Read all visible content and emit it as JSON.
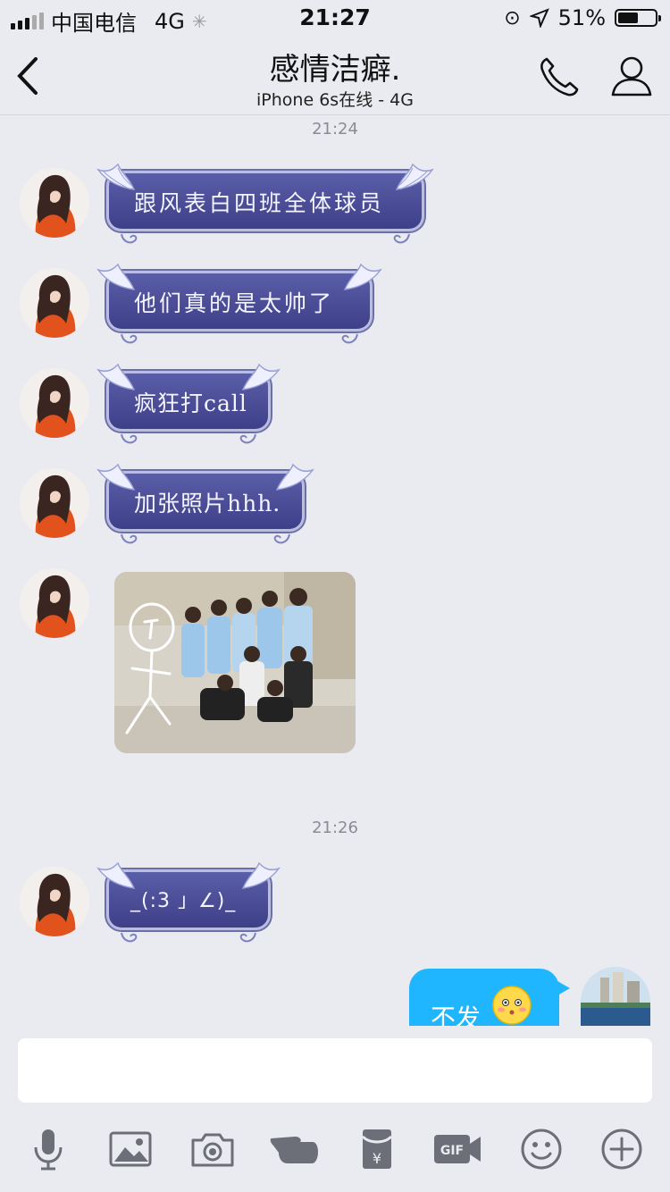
{
  "status_bar": {
    "carrier": "中国电信",
    "network": "4G",
    "time": "21:27",
    "battery": "51%"
  },
  "header": {
    "title": "感情洁癖.",
    "subtitle": "iPhone 6s在线 - 4G"
  },
  "timestamps": [
    "21:24",
    "21:26"
  ],
  "messages": [
    {
      "text": "跟风表白四班全体球员"
    },
    {
      "text": "他们真的是太帅了"
    },
    {
      "text": "疯狂打call"
    },
    {
      "text": "加张照片hhh."
    },
    {
      "text": "_(:3 」∠)_"
    }
  ],
  "outgoing": {
    "text": "不发"
  },
  "input": {
    "placeholder": ""
  },
  "toolbar": [
    "microphone-icon",
    "image-icon",
    "camera-icon",
    "poke-icon",
    "red-packet-icon",
    "gif-icon",
    "emoji-icon",
    "plus-icon"
  ]
}
